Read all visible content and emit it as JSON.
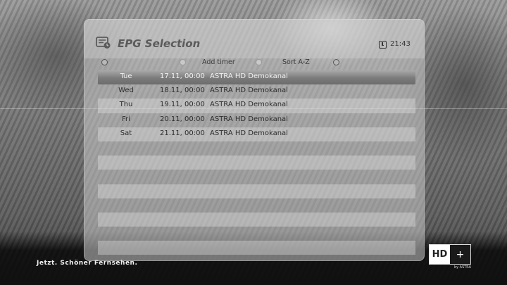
{
  "panel": {
    "title": "EPG Selection",
    "clock": "21:43",
    "icon": "epg-list-icon"
  },
  "buttons": [
    {
      "color": "red",
      "label": ""
    },
    {
      "color": "green",
      "label": "Add timer"
    },
    {
      "color": "yellow",
      "label": "Sort A-Z"
    },
    {
      "color": "blue",
      "label": ""
    }
  ],
  "events": [
    {
      "day": "Tue",
      "datetime": "17.11, 00:00",
      "channel": "ASTRA HD Demokanal",
      "selected": true
    },
    {
      "day": "Wed",
      "datetime": "18.11, 00:00",
      "channel": "ASTRA HD Demokanal",
      "selected": false
    },
    {
      "day": "Thu",
      "datetime": "19.11, 00:00",
      "channel": "ASTRA HD Demokanal",
      "selected": false
    },
    {
      "day": "Fri",
      "datetime": "20.11, 00:00",
      "channel": "ASTRA HD Demokanal",
      "selected": false
    },
    {
      "day": "Sat",
      "datetime": "21.11, 00:00",
      "channel": "ASTRA HD Demokanal",
      "selected": false
    }
  ],
  "footer": {
    "slogan": "Jetzt. Schöner Fernsehen.",
    "logo_hd": "HD",
    "logo_plus": "+",
    "logo_sub": "by ASTRA"
  }
}
